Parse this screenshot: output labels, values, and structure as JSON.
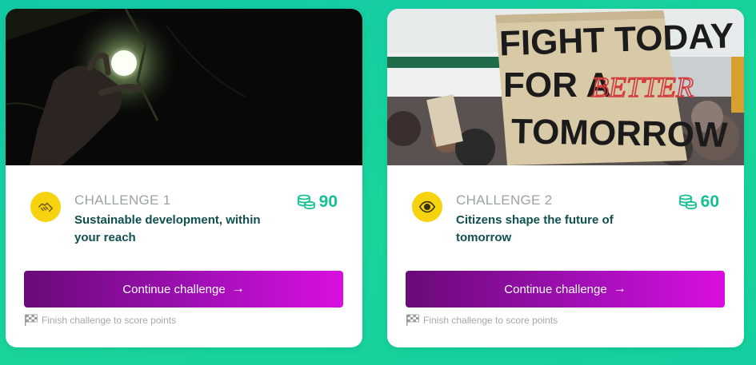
{
  "colors": {
    "background": "#14cfa0",
    "badge": "#f7d20f",
    "points": "#16c094",
    "title": "#0f4f4f",
    "button_start": "#6a0a78",
    "button_end": "#d90fe0"
  },
  "challenges": [
    {
      "label": "CHALLENGE 1",
      "title": "Sustainable development, within your reach",
      "points": "90",
      "points_icon": "coins-icon",
      "badge_icon": "handshake-icon",
      "button_label": "Continue challenge",
      "button_arrow": "→",
      "hint_icon": "checkered-flag-icon",
      "hint": "Finish challenge to score points",
      "image": "hand-with-light-bulb-photo"
    },
    {
      "label": "CHALLENGE 2",
      "title": "Citizens shape the future of tomorrow",
      "points": "60",
      "points_icon": "coins-icon",
      "badge_icon": "eye-icon",
      "button_label": "Continue challenge",
      "button_arrow": "→",
      "hint_icon": "checkered-flag-icon",
      "hint": "Finish challenge to score points",
      "image": "protest-sign-photo",
      "sign_lines": [
        "FIGHT TODAY",
        "FOR A",
        "BETTER",
        "TOMORROW"
      ]
    }
  ]
}
